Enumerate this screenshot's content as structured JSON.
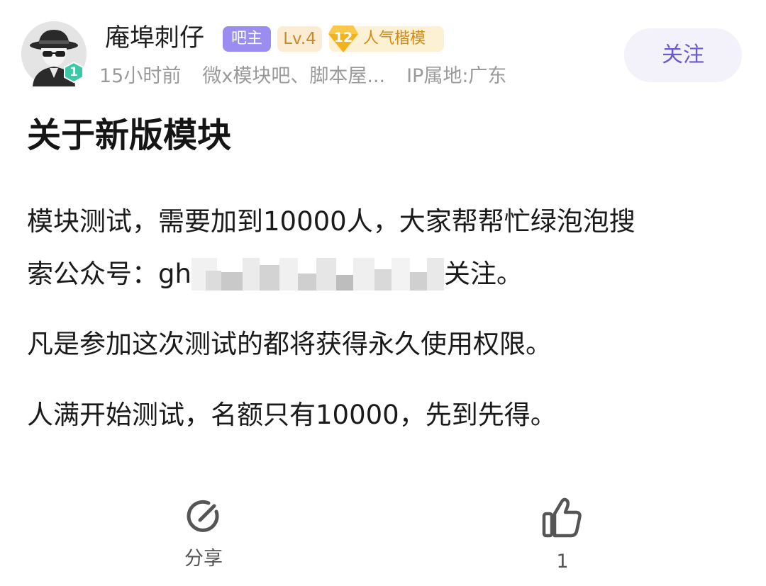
{
  "post": {
    "author": {
      "name": "庵埠刺仔",
      "avatar_icon": "spy-avatar-icon",
      "level_number": "1",
      "badges": {
        "owner": "吧主",
        "level": "Lv.4",
        "popularity_level": "12",
        "popularity_label": "人气楷模"
      },
      "time": "15小时前",
      "forums": "微x模块吧、脚本屋...",
      "ip_location": "IP属地:广东"
    },
    "follow_label": "关注",
    "title": "关于新版模块",
    "body": {
      "para1_line1": "模块测试，需要加到10000人，大家帮帮忙绿泡泡搜",
      "para1_line2_before": "索公众号：",
      "para1_line2_partial": "gh",
      "para1_line2_after": "关注。",
      "para2": "凡是参加这次测试的都将获得永久使用权限。",
      "para3": "人满开始测试，名额只有10000，先到先得。"
    },
    "actions": {
      "share_label": "分享",
      "share_icon": "share-icon",
      "like_count": "1",
      "like_icon": "thumbs-up-icon"
    }
  },
  "colors": {
    "accent": "#6a5acd",
    "owner_badge": "#9b8cf0",
    "level_badge_text": "#c98a2a",
    "popularity_text": "#d48a14",
    "meta_text": "#9a9a9a",
    "level_gem": "#3cc9a8"
  }
}
